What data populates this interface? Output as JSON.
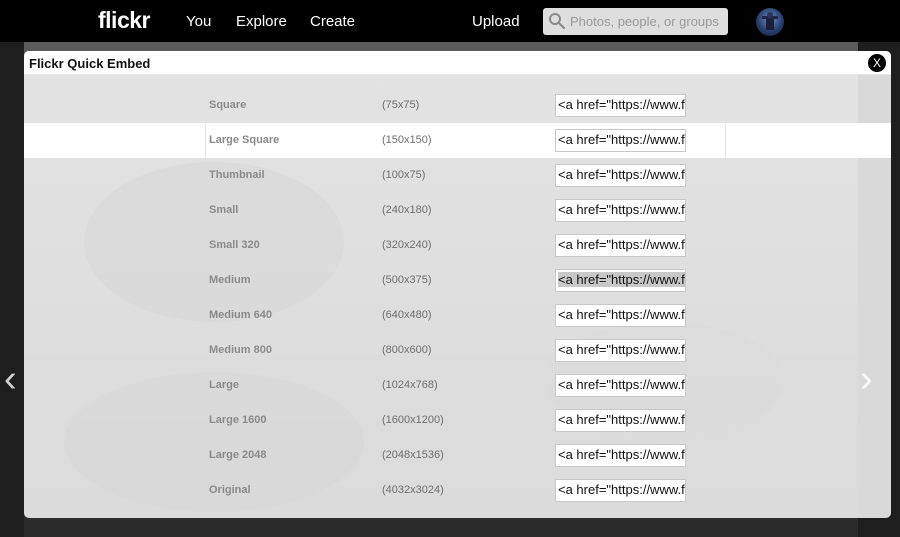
{
  "nav": {
    "logo": "flickr",
    "links": [
      "You",
      "Explore",
      "Create"
    ],
    "upload": "Upload",
    "search_placeholder": "Photos, people, or groups"
  },
  "modal": {
    "title": "Flickr Quick Embed",
    "close_label": "X",
    "sizes": [
      {
        "name": "Square",
        "dims": "(75x75)",
        "code": "<a href=\"https://www.f"
      },
      {
        "name": "Large Square",
        "dims": "(150x150)",
        "code": "<a href=\"https://www.f"
      },
      {
        "name": "Thumbnail",
        "dims": "(100x75)",
        "code": "<a href=\"https://www.f"
      },
      {
        "name": "Small",
        "dims": "(240x180)",
        "code": "<a href=\"https://www.f"
      },
      {
        "name": "Small 320",
        "dims": "(320x240)",
        "code": "<a href=\"https://www.f"
      },
      {
        "name": "Medium",
        "dims": "(500x375)",
        "code": "<a href=\"https://www.f"
      },
      {
        "name": "Medium 640",
        "dims": "(640x480)",
        "code": "<a href=\"https://www.f"
      },
      {
        "name": "Medium 800",
        "dims": "(800x600)",
        "code": "<a href=\"https://www.f"
      },
      {
        "name": "Large",
        "dims": "(1024x768)",
        "code": "<a href=\"https://www.f"
      },
      {
        "name": "Large 1600",
        "dims": "(1600x1200)",
        "code": "<a href=\"https://www.f"
      },
      {
        "name": "Large 2048",
        "dims": "(2048x1536)",
        "code": "<a href=\"https://www.f"
      },
      {
        "name": "Original",
        "dims": "(4032x3024)",
        "code": "<a href=\"https://www.f"
      }
    ]
  }
}
